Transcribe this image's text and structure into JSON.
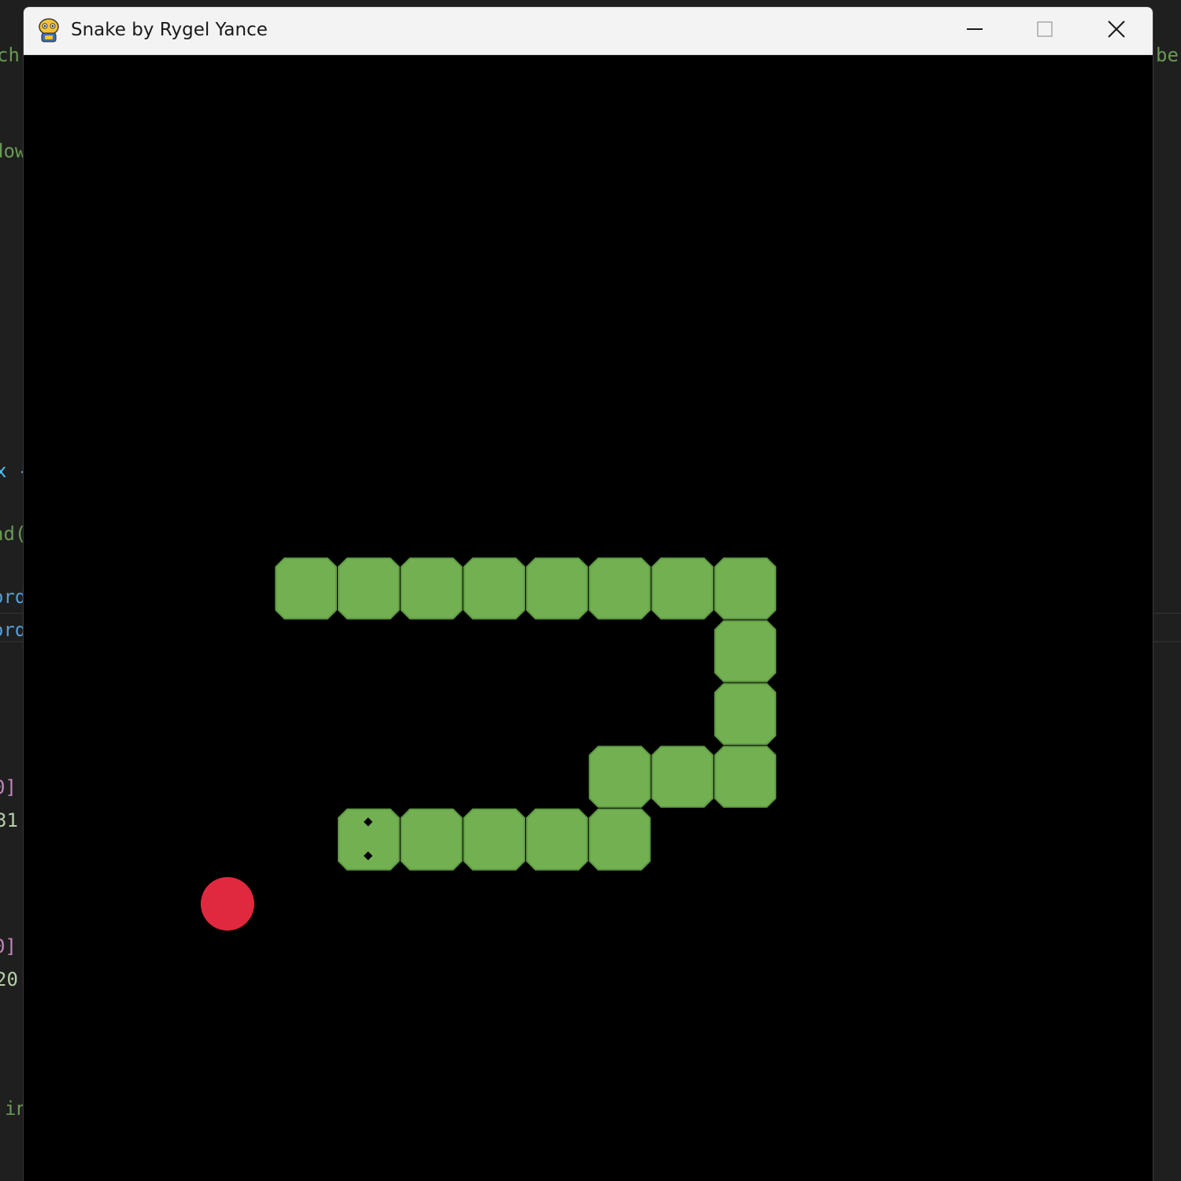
{
  "window": {
    "title": "Snake by Rygel Yance",
    "app_icon": "pygame-snake-icon",
    "controls": {
      "minimize": "minimize-icon",
      "maximize": "maximize-icon",
      "close": "close-icon"
    }
  },
  "background_editor": {
    "fragments": [
      {
        "text": "ch",
        "color": "#6a9955"
      },
      {
        "text": "dow",
        "color": "#6a9955"
      },
      {
        "text": "x -",
        "color": "#4fc1ff"
      },
      {
        "text": "nd(",
        "color": "#6a9955"
      },
      {
        "text": "ord",
        "color": "#569cd6"
      },
      {
        "text": "ord",
        "color": "#569cd6"
      },
      {
        "text": "0]",
        "color": "#c586c0"
      },
      {
        "text": "31",
        "color": "#b5cea8"
      },
      {
        "text": "0]",
        "color": "#c586c0"
      },
      {
        "text": "20",
        "color": "#b5cea8"
      },
      {
        "text": "in",
        "color": "#6a9955"
      },
      {
        "text": "be",
        "color": "#6a9955"
      }
    ]
  },
  "game": {
    "grid_cols": 18,
    "grid_rows": 18,
    "colors": {
      "background": "#000000",
      "snake": "#73b052",
      "snake_edge": "#5f9a43",
      "food": "#e0283f",
      "eyes": "#000000"
    },
    "direction": "left",
    "snake": [
      {
        "col": 5,
        "row": 12
      },
      {
        "col": 6,
        "row": 12
      },
      {
        "col": 7,
        "row": 12
      },
      {
        "col": 8,
        "row": 12
      },
      {
        "col": 9,
        "row": 12
      },
      {
        "col": 9,
        "row": 11
      },
      {
        "col": 10,
        "row": 11
      },
      {
        "col": 11,
        "row": 11
      },
      {
        "col": 11,
        "row": 10
      },
      {
        "col": 11,
        "row": 9
      },
      {
        "col": 11,
        "row": 8
      },
      {
        "col": 10,
        "row": 8
      },
      {
        "col": 9,
        "row": 8
      },
      {
        "col": 8,
        "row": 8
      },
      {
        "col": 7,
        "row": 8
      },
      {
        "col": 6,
        "row": 8
      },
      {
        "col": 5,
        "row": 8
      },
      {
        "col": 4,
        "row": 8
      }
    ],
    "food": {
      "col": 3,
      "row": 13
    }
  }
}
